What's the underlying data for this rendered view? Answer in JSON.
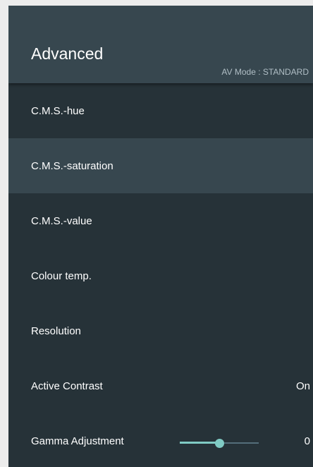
{
  "header": {
    "title": "Advanced",
    "av_mode": "AV Mode : STANDARD"
  },
  "menu": {
    "items": [
      {
        "label": "C.M.S.-hue",
        "value": ""
      },
      {
        "label": "C.M.S.-saturation",
        "value": "",
        "selected": true
      },
      {
        "label": "C.M.S.-value",
        "value": ""
      },
      {
        "label": "Colour temp.",
        "value": ""
      },
      {
        "label": "Resolution",
        "value": ""
      },
      {
        "label": "Active Contrast",
        "value": "On"
      },
      {
        "label": "Gamma Adjustment",
        "value": "0"
      }
    ]
  },
  "gamma_slider": {
    "value": 0,
    "min": -3,
    "max": 3,
    "accent_color": "#80cbc4",
    "track_color": "#546e7a"
  },
  "colors": {
    "panel_bg": "#263238",
    "header_bg": "#37474f",
    "selected_bg": "#37474f"
  }
}
